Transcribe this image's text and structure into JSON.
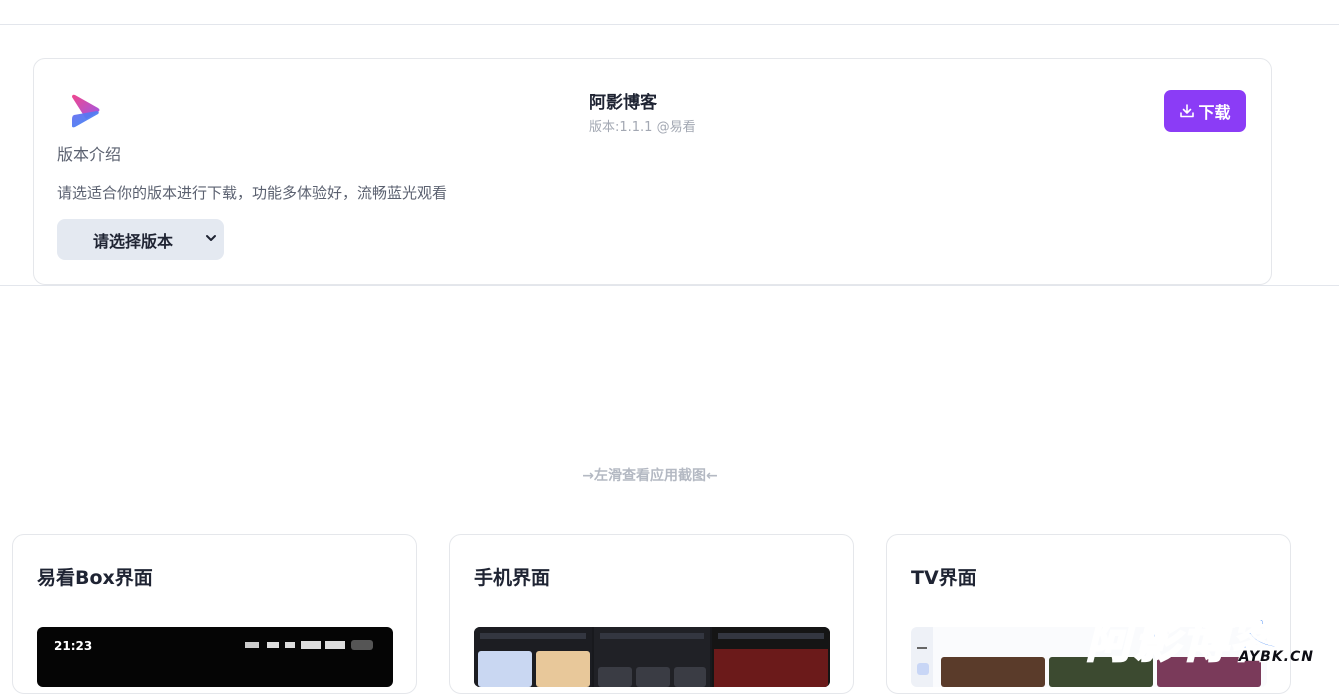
{
  "header": {
    "app_name": "阿影博客",
    "meta": "版本:1.1.1 @易看",
    "download_label": "下载",
    "intro_title": "版本介绍",
    "intro_desc": "请选适合你的版本进行下载，功能多体验好，流畅蓝光观看",
    "version_select": {
      "selected": "请选择版本"
    }
  },
  "swipe_hint": "→左滑查看应用截图←",
  "screenshots": [
    {
      "title": "易看Box界面",
      "status_time": "21:23"
    },
    {
      "title": "手机界面"
    },
    {
      "title": "TV界面"
    }
  ],
  "watermark": {
    "main": "阿影博客",
    "sub": "AYBK.CN"
  },
  "colors": {
    "accent": "#8b3cf6",
    "select_bg": "#e4e9f1",
    "watermark": "#1d6ff2"
  },
  "icons": [
    "app-logo",
    "download-icon",
    "chevron-down-icon"
  ]
}
